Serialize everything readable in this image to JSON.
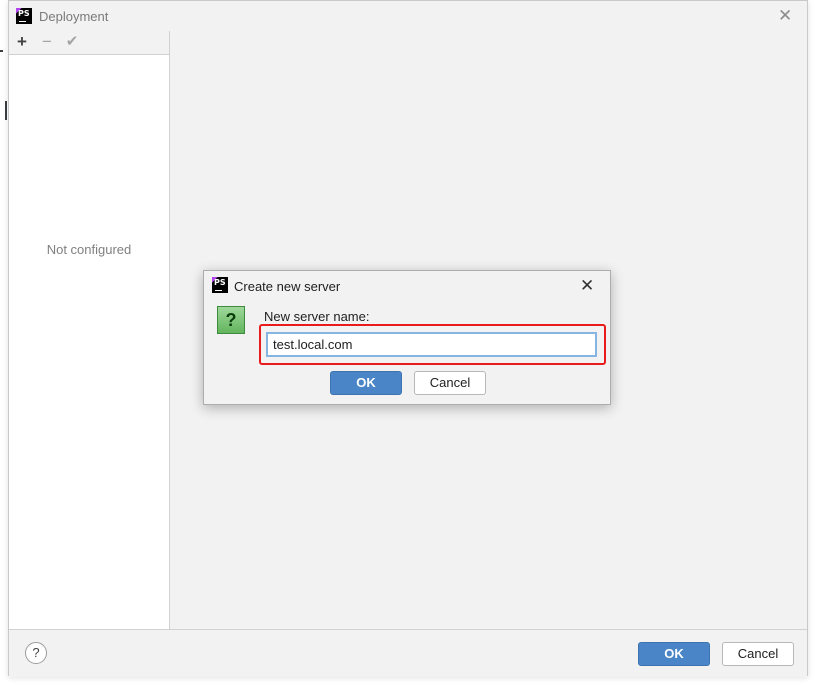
{
  "window": {
    "title": "Deployment",
    "app_icon_text": "PS",
    "close_icon": "close-icon"
  },
  "toolbar": {
    "add_icon": "plus-icon",
    "remove_icon": "minus-icon",
    "apply_icon": "checkmark-icon"
  },
  "left_panel": {
    "empty_text": "Not configured"
  },
  "footer": {
    "help_label": "?",
    "ok_label": "OK",
    "cancel_label": "Cancel"
  },
  "dialog": {
    "title": "Create new server",
    "app_icon_text": "PS",
    "question_icon_label": "?",
    "field_label": "New server name:",
    "input_value": "test.local.com",
    "ok_label": "OK",
    "cancel_label": "Cancel"
  },
  "colors": {
    "primary_button": "#4a86c7",
    "highlight_border": "#e81c1c",
    "input_focus_border": "#87b5e3"
  }
}
